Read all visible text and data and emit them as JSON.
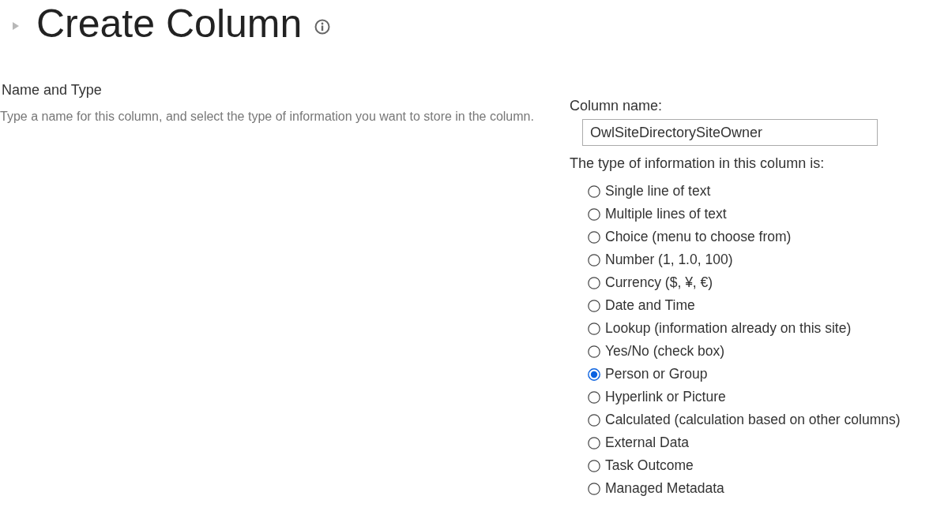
{
  "page": {
    "title": "Create Column"
  },
  "section": {
    "heading": "Name and Type",
    "description": "Type a name for this column, and select the type of information you want to store in the column."
  },
  "column_name": {
    "label": "Column name:",
    "value": "OwlSiteDirectorySiteOwner"
  },
  "type_label": "The type of information in this column is:",
  "types": [
    {
      "label": "Single line of text",
      "selected": false
    },
    {
      "label": "Multiple lines of text",
      "selected": false
    },
    {
      "label": "Choice (menu to choose from)",
      "selected": false
    },
    {
      "label": "Number (1, 1.0, 100)",
      "selected": false
    },
    {
      "label": "Currency ($, ¥, €)",
      "selected": false
    },
    {
      "label": "Date and Time",
      "selected": false
    },
    {
      "label": "Lookup (information already on this site)",
      "selected": false
    },
    {
      "label": "Yes/No (check box)",
      "selected": false
    },
    {
      "label": "Person or Group",
      "selected": true
    },
    {
      "label": "Hyperlink or Picture",
      "selected": false
    },
    {
      "label": "Calculated (calculation based on other columns)",
      "selected": false
    },
    {
      "label": "External Data",
      "selected": false
    },
    {
      "label": "Task Outcome",
      "selected": false
    },
    {
      "label": "Managed Metadata",
      "selected": false
    }
  ]
}
